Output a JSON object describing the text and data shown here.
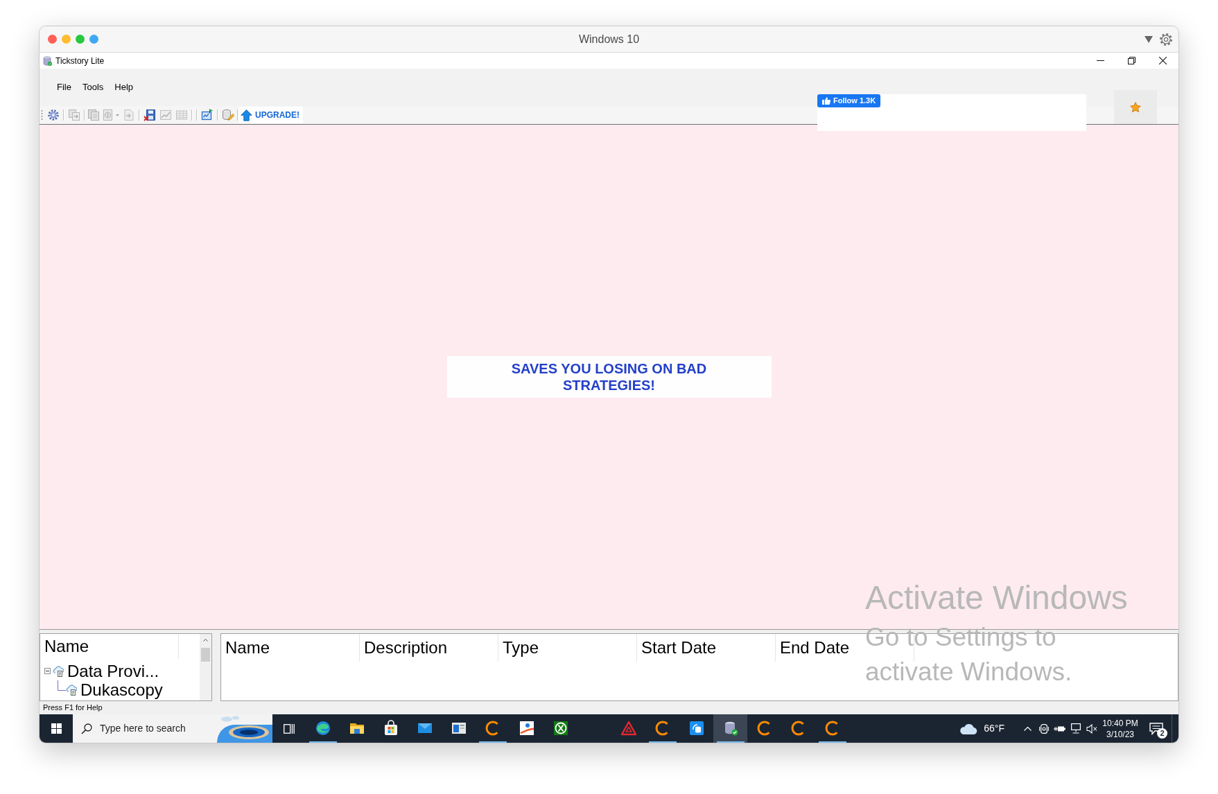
{
  "host_window": {
    "title": "Windows 10"
  },
  "app_window": {
    "title": "Tickstory Lite"
  },
  "menu": [
    {
      "label": "File"
    },
    {
      "label": "Tools"
    },
    {
      "label": "Help"
    }
  ],
  "toolbar": {
    "buttons": [
      {
        "disabled": false
      },
      {
        "disabled": true
      },
      {
        "disabled": true
      },
      {
        "disabled": true
      },
      {
        "disabled": true
      },
      {
        "disabled": false
      },
      {
        "disabled": true
      },
      {
        "disabled": true
      },
      {
        "disabled": false
      },
      {
        "disabled": false
      }
    ],
    "upgrade_button": {
      "label": "UPGRADE!"
    }
  },
  "follow_widget": {
    "label": "Follow 1.3K"
  },
  "ad_banner": {
    "text": "SAVES YOU LOSING ON BAD STRATEGIES!"
  },
  "tree_panel": {
    "column": "Name",
    "items": [
      {
        "label": "Data Provi...",
        "expanded": true,
        "children": [
          {
            "label": "Dukascopy"
          }
        ]
      }
    ]
  },
  "list_panel": {
    "columns": [
      "Name",
      "Description",
      "Type",
      "Start Date",
      "End Date"
    ]
  },
  "status_bar": {
    "text": "Press F1 for Help"
  },
  "activation_notice": {
    "title": "Activate Windows",
    "message": "Go to Settings to activate Windows."
  },
  "taskbar": {
    "search": {
      "placeholder": "Type here to search"
    },
    "apps": [
      {
        "running": true,
        "selected": false
      },
      {
        "running": false,
        "selected": false
      },
      {
        "running": false,
        "selected": false
      },
      {
        "running": false,
        "selected": false
      },
      {
        "running": false,
        "selected": false
      },
      {
        "running": true,
        "selected": false
      },
      {
        "running": false,
        "selected": false
      },
      {
        "running": false,
        "selected": false
      },
      {
        "running": false,
        "selected": false
      },
      {
        "running": true,
        "selected": false
      },
      {
        "running": false,
        "selected": false
      },
      {
        "running": true,
        "selected": true
      },
      {
        "running": false,
        "selected": false
      },
      {
        "running": false,
        "selected": false
      },
      {
        "running": true,
        "selected": false
      }
    ],
    "weather": {
      "temperature": "66°F"
    },
    "clock": {
      "time": "10:40 PM",
      "date": "3/10/23"
    },
    "notifications": {
      "count": "2"
    }
  }
}
